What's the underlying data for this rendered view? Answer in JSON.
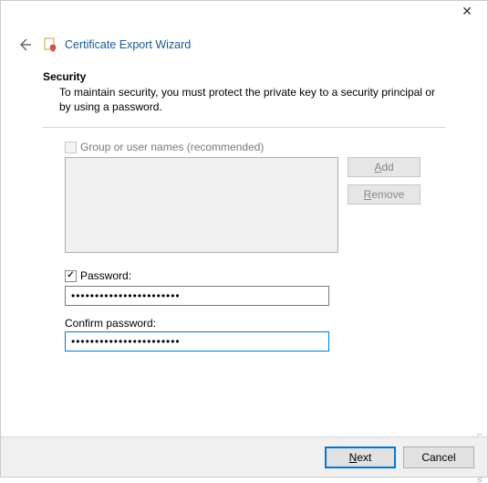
{
  "window": {
    "title": "Certificate Export Wizard",
    "close_glyph": "✕"
  },
  "section": {
    "heading": "Security",
    "description": "To maintain security, you must protect the private key to a security principal or by using a password."
  },
  "group_option": {
    "label": "Group or user names (recommended)",
    "checked": false,
    "enabled": false
  },
  "buttons": {
    "add_prefix": "A",
    "add_rest": "dd",
    "remove_prefix": "R",
    "remove_rest": "emove"
  },
  "password_option": {
    "label": "Password:",
    "checked": true,
    "value": "•••••••••••••••••••••••",
    "confirm_label": "Confirm password:",
    "confirm_value": "•••••••••••••••••••••••"
  },
  "footer": {
    "next_prefix": "N",
    "next_rest": "ext",
    "cancel": "Cancel"
  },
  "watermark": "wsxdn.com"
}
